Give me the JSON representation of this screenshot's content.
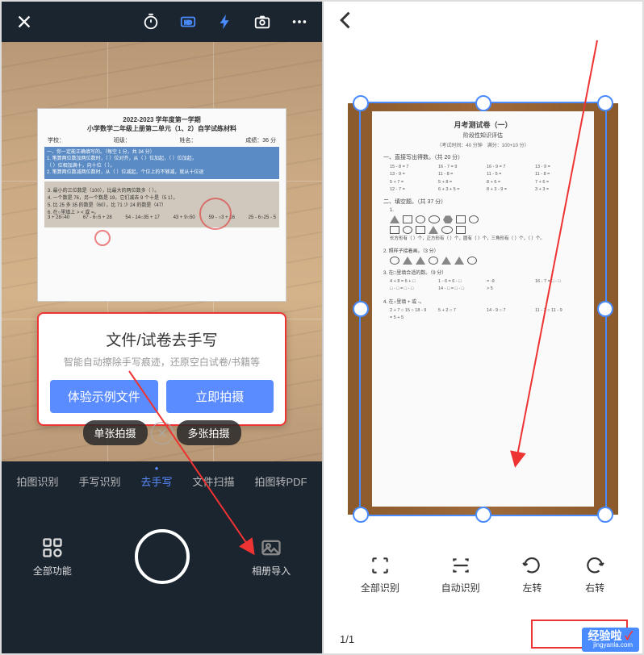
{
  "left": {
    "topbar_icons": [
      "close",
      "timer",
      "hd",
      "flash",
      "camera",
      "more"
    ],
    "paper": {
      "year": "2022-2023 学年度第一学期",
      "title": "小学数学二年级上册第二单元（1、2）自学试练材料",
      "school_row": [
        "学校：",
        "班级：",
        "姓名：",
        "成绩：36 分"
      ],
      "blue1": "一、你一定能正确填写的。（每空 1 分，共 34 分）",
      "blue2_a": "1. 笔算两位数加两位数时，（  ）位对齐，从（  ）位加起，（  ）位加起，",
      "blue2_b": "（  ）位相加满十，向十位（  ）。",
      "blue2_c": "2. 笔算两位数减两位数时，从（  ）位减起，个位上的不够减，就从十位退",
      "grey_a": "3. 最小的三位数是（100），比最大的两位数多（  ）。",
      "grey_b": "4. 一个数是 76，另一个数是 19，它们减去 9 个十是（5 1）。",
      "grey_c": "5. 比 25 多 35 的数是（60），比 71 少 24 的数是（47）",
      "grey_d": "6. 在○里填上 > < 或 =。",
      "sums": [
        "3 + 28○40",
        "67 - 6○5 + 28",
        "54 - 14○35 + 17",
        "43 + 9○50",
        "59 - ○3 + 16",
        "25 - 6○25 - 5"
      ]
    },
    "popup": {
      "title": "文件/试卷去手写",
      "subtitle": "智能自动擦除手写痕迹，还原空白试卷/书籍等",
      "btn_sample": "体验示例文件",
      "btn_shoot": "立即拍摄"
    },
    "chips": {
      "single": "单张拍摄",
      "multi": "多张拍摄"
    },
    "tabs": [
      "拍图识别",
      "手写识别",
      "去手写",
      "文件扫描",
      "拍图转PDF"
    ],
    "active_tab": 2,
    "bottom": {
      "all": "全部功能",
      "album": "相册导入"
    }
  },
  "right": {
    "paper": {
      "title": "月考测试卷（一）",
      "subtitle": "阶段性知识评估",
      "meta": "（考试时间：40 分钟　满分：100+10 分）",
      "sec1": "一、直接写出得数。（共 20 分）",
      "nums1": [
        "15 - 8 = 7",
        "16 - 7 = 9",
        "16 - 9 = 7",
        "13 - 9 =",
        "13 - 9 =",
        "11 - 8 =",
        "11 - 5 =",
        "11 - 8 =",
        "5 + 7 =",
        "5 + 8 =",
        "8 + 6 =",
        "7 + 6 =",
        "12 - 7 =",
        "6 + 3 + 5 =",
        "8 + 3 - 9 =",
        "3 + 3 ="
      ],
      "sec2": "二、填空题。（共 37 分）",
      "shapes_label": "长方形有（  ）个，正方形有（  ）个，圆有（  ）个，三角形有（  ）个，（  ）个。",
      "sec2_2": "2. 照样子接着画。（3 分）",
      "sec2_3": "3. 在□里填合适的数。（9 分）",
      "nums3": [
        "4 + 8 = 5 + □",
        "1 - 6 = 6 - □",
        "= -9",
        "16 - 7 = □ - □",
        "□ - □ = □ - □",
        "14 - □ = □ - □",
        "> 5"
      ],
      "sec2_4": "4. 在○里填 + 或 -。",
      "nums4": [
        "2 + 7 ○ 15 ○ 18 - 9",
        "5 + 2 ○ 7",
        "14 - 9 ○ 7",
        "11 - 2 ○ 11 - 9",
        "= 5 + 5"
      ]
    },
    "actions": {
      "full": "全部识别",
      "auto": "自动识别",
      "left": "左转",
      "right": "右转"
    },
    "page": "1/1"
  },
  "watermark": {
    "brand": "经验啦",
    "url": "jingyanla.com"
  }
}
